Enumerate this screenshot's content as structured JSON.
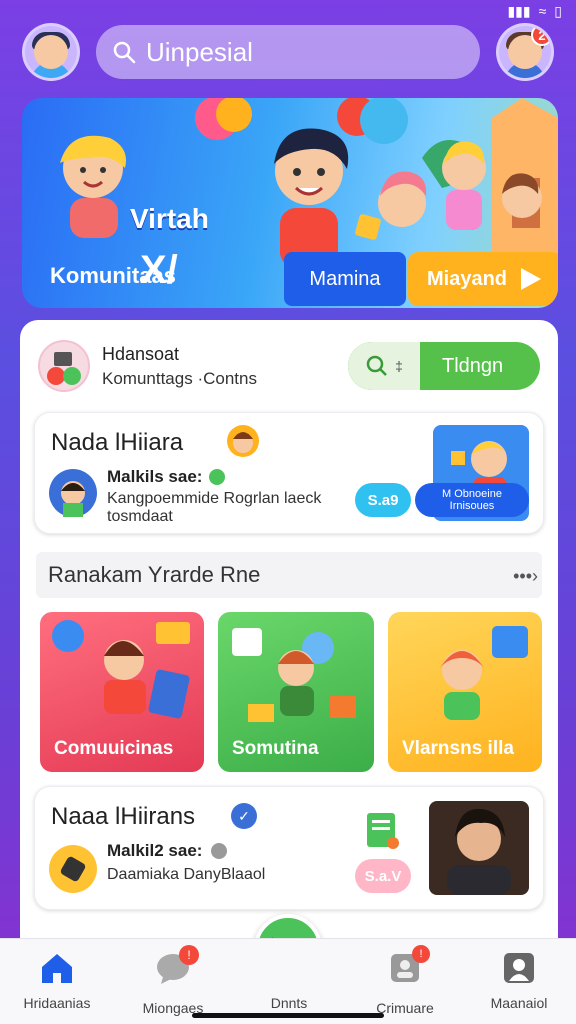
{
  "search": {
    "placeholder": "Uinpesial"
  },
  "header": {
    "notification_count": "2"
  },
  "hero": {
    "title_mark": "X/",
    "title": "Virtah",
    "subtitle": "Komunitaas",
    "button_secondary": "Mamina",
    "button_primary": "Miayand"
  },
  "profile": {
    "name": "Hdansoat",
    "subtitle": "Komunttags ·Contns",
    "toggle_label": "Tldngn"
  },
  "card1": {
    "title": "Nada lHiiara",
    "meta_title": "Malkils sae:",
    "meta_sub_1": "Kangpoemmide Rogrlan laeck",
    "meta_sub_2": "tosmdaat",
    "pill": "S.a9",
    "pill2": "M Obnoeine Irnisoues"
  },
  "section": {
    "title": "Ranakam Yrarde Rne",
    "more": "•••›"
  },
  "tiles": [
    {
      "label": "Comuuicinas",
      "color": "#f04e5e"
    },
    {
      "label": "Somutina",
      "color": "#4cc35a"
    },
    {
      "label": "Vlarnsns illa",
      "color": "#ffc233"
    }
  ],
  "card2": {
    "title": "Naaa lHiirans",
    "meta_title": "Malkil2 sae:",
    "meta_sub": "Daamiaka DanyBlaaol",
    "pill": "S.a.V"
  },
  "nav": {
    "items": [
      {
        "label": "Hridaanias"
      },
      {
        "label": "Miongaes"
      },
      {
        "label": "Dnnts"
      },
      {
        "label": "Crimuare"
      },
      {
        "label": "Maanaiol"
      }
    ],
    "badge": "!"
  },
  "colors": {
    "accent": "#4cc35a",
    "hero_primary": "#ffb21e",
    "brand": "#2a6cf5"
  }
}
